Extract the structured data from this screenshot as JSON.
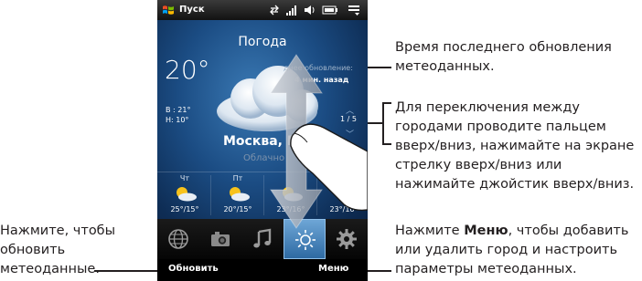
{
  "status_bar": {
    "start_label": "Пуск",
    "icons": [
      "windows-flag-icon",
      "sync-icon",
      "signal-icon",
      "volume-icon",
      "battery-icon",
      "menu-icon"
    ]
  },
  "weather": {
    "title": "Погода",
    "temperature": "20°",
    "high": "В : 21°",
    "low": "Н: 10°",
    "update_label": "днее обновление:",
    "update_time": "4 мин. назад",
    "city_counter": "1 / 5",
    "city": "Москва, Р",
    "condition": "Облачно",
    "forecast": [
      {
        "day": "Чт",
        "temp": "25°/15°",
        "icon": "sun-cloud-icon"
      },
      {
        "day": "Пт",
        "temp": "20°/15°",
        "icon": "sun-cloud-icon"
      },
      {
        "day": "",
        "temp": "23°/16°",
        "icon": "sun-cloud-icon"
      },
      {
        "day": "",
        "temp": "23°/16°",
        "icon": "sun-cloud-icon"
      }
    ]
  },
  "tabs": [
    "globe-icon",
    "camera-icon",
    "music-icon",
    "weather-sun-icon",
    "settings-gear-icon"
  ],
  "softkeys": {
    "left": "Обновить",
    "right": "Меню"
  },
  "callouts": {
    "update_time": "Время последнего обновления метеоданных.",
    "switch_city": "Для переключения между городами проводите пальцем вверх/вниз, нажимайте на экране стрелку вверх/вниз или нажимайте джойстик вверх/вниз.",
    "refresh_line1": "Нажмите, чтобы",
    "refresh_line2": "обновить",
    "refresh_line3": "метеоданные.",
    "menu_bold": "Меню",
    "menu_rest": ", чтобы добавить или удалить город и настроить параметры метеоданных.",
    "menu_prefix": "Нажмите "
  },
  "colors": {
    "panel_blue": "#1b4c83",
    "active_tab": "#4f8cc4",
    "ink": "#231f20"
  }
}
